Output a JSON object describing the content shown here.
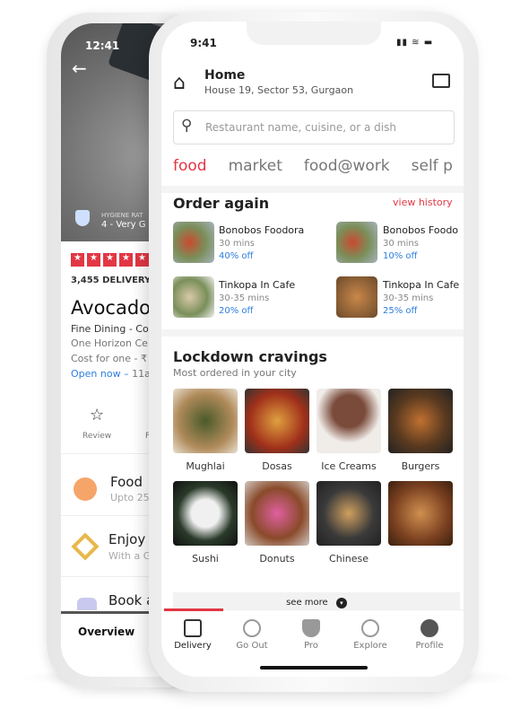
{
  "back": {
    "time": "12:41",
    "hygiene_label": "HYGIENE RAT",
    "hygiene_value": "4 - Very G",
    "deliveries": "3,455 DELIVERY",
    "name": "Avocado",
    "type": "Fine Dining - Co",
    "address": "One Horizon Ce",
    "cost": "Cost for one - ₹",
    "open": "Open now –",
    "hours": " 11a",
    "review": "Review",
    "review2": "F",
    "offers": [
      {
        "title": "Food",
        "sub": "Upto 25"
      },
      {
        "title": "Enjoy",
        "sub": "With a G"
      },
      {
        "title": "Book a",
        "sub": ""
      }
    ],
    "tab": "Overview"
  },
  "front": {
    "time": "9:41",
    "location_title": "Home",
    "location_sub": "House 19, Sector 53, Gurgaon",
    "search_placeholder": "Restaurant name, cuisine, or a dish",
    "tabs": [
      "food",
      "market",
      "food@work",
      "self p"
    ],
    "order_again": "Order again",
    "view_history": "view history",
    "orders": [
      {
        "name": "Bonobos Foodora",
        "time": "30 mins",
        "offer": "40% off"
      },
      {
        "name": "Bonobos Foodo",
        "time": "30 mins",
        "offer": "10% off"
      },
      {
        "name": "Tinkopa In Cafe",
        "time": "30-35 mins",
        "offer": "20% off"
      },
      {
        "name": "Tinkopa In Cafe",
        "time": "30-35 mins",
        "offer": "25% off"
      }
    ],
    "cravings_title": "Lockdown cravings",
    "cravings_sub": "Most ordered in your city",
    "categories": [
      "Mughlai",
      "Dosas",
      "Ice Creams",
      "Burgers",
      "Sushi",
      "Donuts",
      "Chinese",
      ""
    ],
    "see_more": "see more",
    "nav": [
      "Delivery",
      "Go Out",
      "Pro",
      "Explore",
      "Profile"
    ],
    "accent": "#e23744"
  }
}
